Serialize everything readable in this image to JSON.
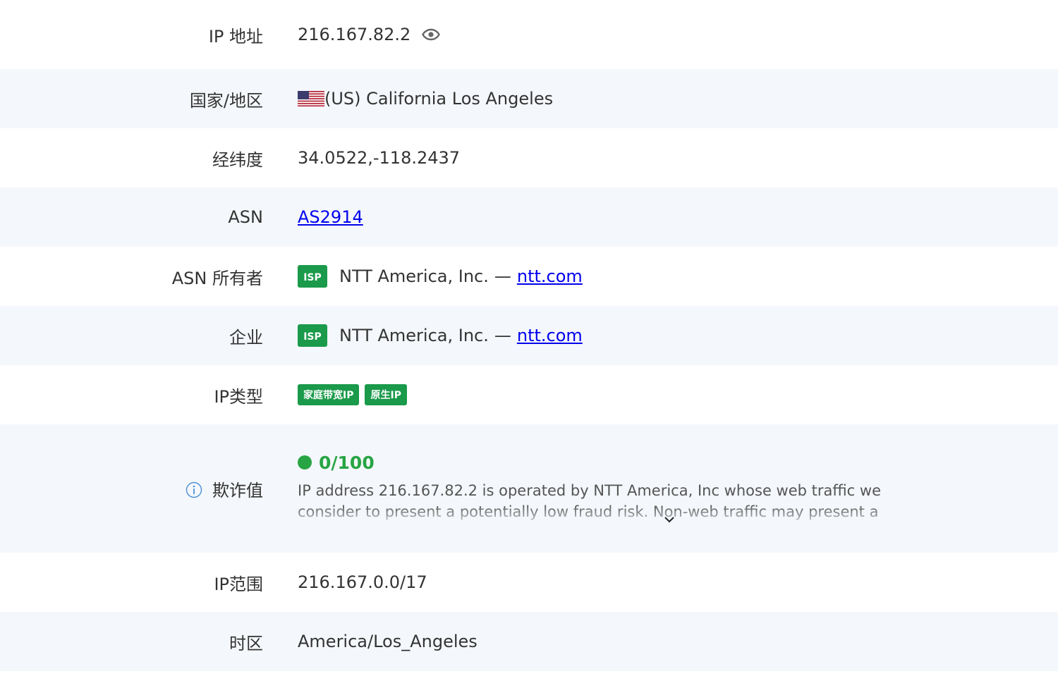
{
  "colors": {
    "row_alt_bg": "#f4f7fb",
    "badge_green": "#1a9a4a",
    "score_green": "#27a544",
    "link_blue": "#0000ee"
  },
  "rows": {
    "ip": {
      "label": "IP 地址",
      "value": "216.167.82.2",
      "icon": "eye-icon"
    },
    "country": {
      "label": "国家/地区",
      "flag": "us-flag-icon",
      "value": "(US) California Los Angeles"
    },
    "coords": {
      "label": "经纬度",
      "value": "34.0522,-118.2437"
    },
    "asn": {
      "label": "ASN",
      "value": "AS2914"
    },
    "asn_owner": {
      "label": "ASN 所有者",
      "badge": "ISP",
      "name": "NTT America, Inc.",
      "sep": "—",
      "domain": "ntt.com"
    },
    "company": {
      "label": "企业",
      "badge": "ISP",
      "name": "NTT America, Inc.",
      "sep": "—",
      "domain": "ntt.com"
    },
    "ip_type": {
      "label": "IP类型",
      "tags": [
        "家庭带宽IP",
        "原生IP"
      ]
    },
    "fraud": {
      "label": "欺诈值",
      "icon": "info-icon",
      "score": "0/100",
      "description": "IP address 216.167.82.2 is operated by NTT America, Inc whose web traffic we consider to present a potentially low fraud risk. Non-web traffic may present a different risk or no risk at all. Scamalytics see low levels of traffic from NTT America, Inc across our global",
      "expand_icon": "chevron-down-icon"
    },
    "ip_range": {
      "label": "IP范围",
      "value": "216.167.0.0/17"
    },
    "timezone": {
      "label": "时区",
      "value": "America/Los_Angeles"
    }
  }
}
